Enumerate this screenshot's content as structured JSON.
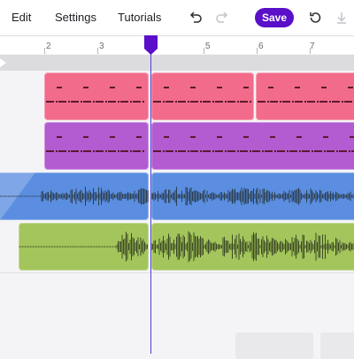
{
  "menu": {
    "edit": "Edit",
    "settings": "Settings",
    "tutorials": "Tutorials"
  },
  "toolbar": {
    "save_label": "Save",
    "icons": [
      "undo-icon",
      "redo-icon",
      "history-icon",
      "download-icon"
    ]
  },
  "ruler": {
    "labels": [
      "2",
      "3",
      "5",
      "6",
      "7"
    ]
  },
  "playhead": {
    "position_beat": 4.0
  },
  "tracks": [
    {
      "name": "pink-beat-track",
      "color": "#f26b8a",
      "type": "pattern"
    },
    {
      "name": "purple-beat-track",
      "color": "#b35bd1",
      "type": "pattern"
    },
    {
      "name": "blue-audio-track",
      "color": "#5b8ee0",
      "type": "audio"
    },
    {
      "name": "green-audio-track",
      "color": "#a3c55c",
      "type": "audio"
    }
  ],
  "colors": {
    "accent": "#5a0fc8",
    "playhead": "#4b3bd6",
    "pattern_dash": "#5a1a30",
    "waveform": "#2b3f4f",
    "waveform_green": "#3d4a24"
  }
}
